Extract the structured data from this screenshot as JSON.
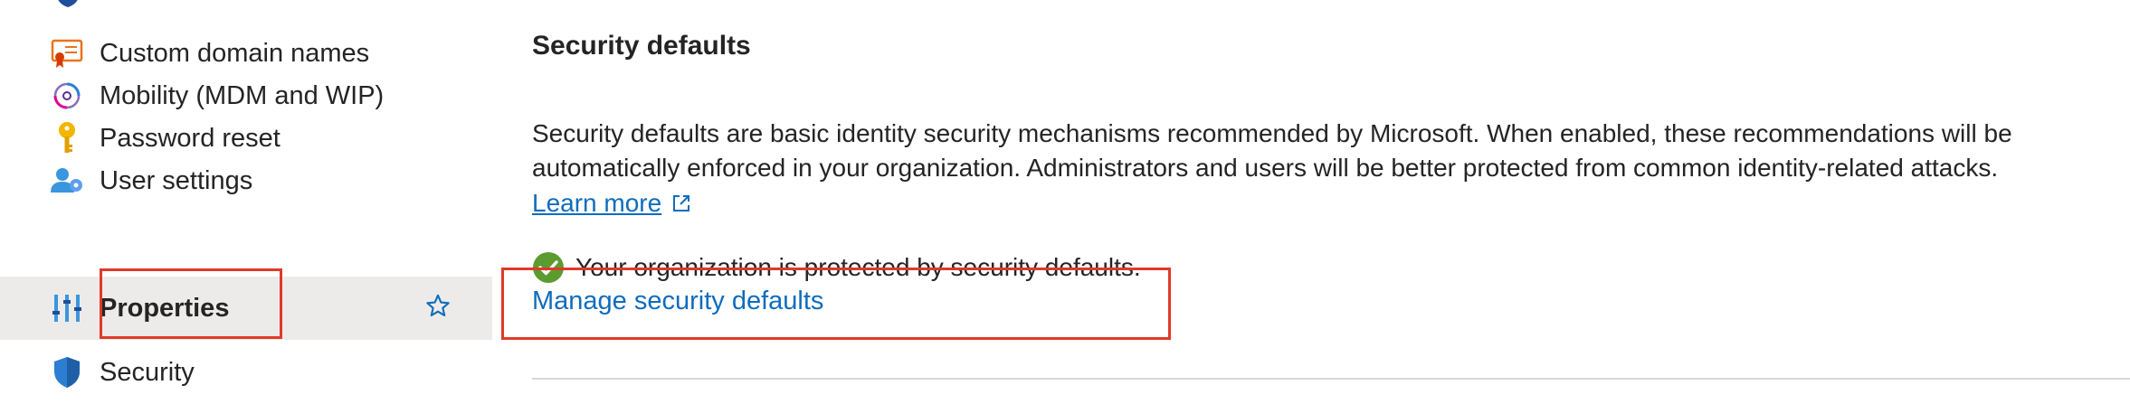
{
  "sidebar": {
    "items": [
      {
        "label": "Custom domain names",
        "icon": "certificate-icon"
      },
      {
        "label": "Mobility (MDM and WIP)",
        "icon": "mobility-icon"
      },
      {
        "label": "Password reset",
        "icon": "key-icon"
      },
      {
        "label": "User settings",
        "icon": "user-settings-icon"
      },
      {
        "label": "Properties",
        "icon": "properties-icon",
        "selected": true
      },
      {
        "label": "Security",
        "icon": "shield-icon"
      }
    ],
    "favorite_icon": "star-icon"
  },
  "main": {
    "title": "Security defaults",
    "description": "Security defaults are basic identity security mechanisms recommended by Microsoft. When enabled, these recommendations will be automatically enforced in your organization. Administrators and users will be better protected from common identity-related attacks.",
    "learn_more": "Learn more",
    "status_message": "Your organization is protected by security defaults.",
    "manage_link": "Manage security defaults"
  },
  "colors": {
    "link": "#0f6cbd",
    "success": "#5b9b2f",
    "highlight": "#e03a28",
    "selected_bg": "#edebe9"
  }
}
